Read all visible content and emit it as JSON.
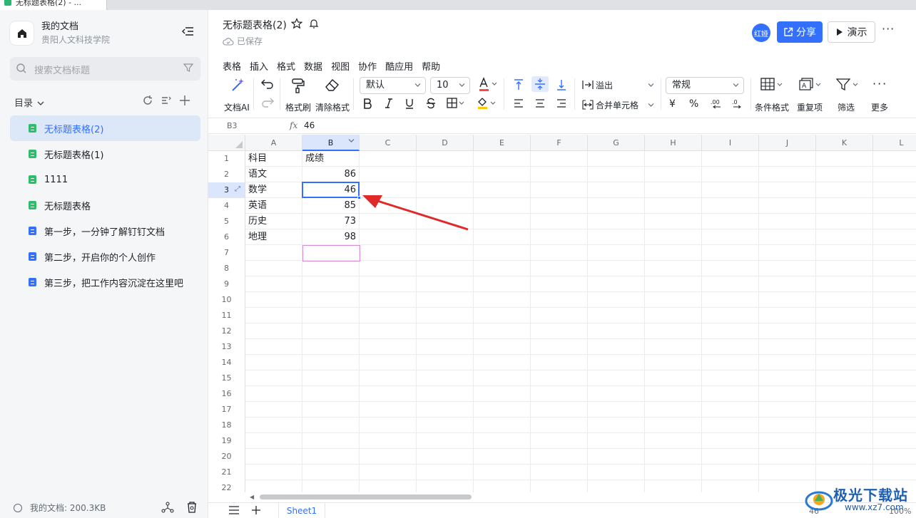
{
  "browser_tab": {
    "title": "无标题表格(2) - ..."
  },
  "sidebar": {
    "workspace_title": "我的文档",
    "workspace_subtitle": "贵阳人文科技学院",
    "search_placeholder": "搜索文档标题",
    "directory_label": "目录",
    "items": [
      {
        "label": "无标题表格(2)",
        "type": "sheet",
        "active": true
      },
      {
        "label": "无标题表格(1)",
        "type": "sheet",
        "active": false
      },
      {
        "label": "1111",
        "type": "sheet",
        "active": false
      },
      {
        "label": "无标题表格",
        "type": "sheet",
        "active": false
      },
      {
        "label": "第一步，一分钟了解钉钉文档",
        "type": "doc",
        "active": false
      },
      {
        "label": "第二步，开启你的个人创作",
        "type": "doc",
        "active": false
      },
      {
        "label": "第三步，把工作内容沉淀在这里吧",
        "type": "doc",
        "active": false
      }
    ],
    "storage_text": "我的文档: 200.3KB"
  },
  "header": {
    "doc_title": "无标题表格(2)",
    "saved_status": "已保存",
    "avatar_text": "红娅",
    "share_label": "分享",
    "present_label": "演示",
    "more_label": "···"
  },
  "menubar": [
    "表格",
    "插入",
    "格式",
    "数据",
    "视图",
    "协作",
    "酷应用",
    "帮助"
  ],
  "toolbar": {
    "ai_label": "文档AI",
    "format_painter_label": "格式刷",
    "clear_format_label": "清除格式",
    "font_name": "默认",
    "font_size": "10",
    "overflow_label": "溢出",
    "merge_label": "合并单元格",
    "number_format": "常规",
    "conditional_format_label": "条件格式",
    "duplicates_label": "重复项",
    "filter_label": "筛选",
    "more_label": "更多",
    "accent_color": "#3370ff",
    "font_color": "#f54a45",
    "fill_color": "#ffc60a"
  },
  "formula_bar": {
    "cell_ref": "B3",
    "fx": "fx",
    "value": "46"
  },
  "grid": {
    "columns": [
      "A",
      "B",
      "C",
      "D",
      "E",
      "F",
      "G",
      "H",
      "I",
      "J",
      "K",
      "L"
    ],
    "selected_column": "B",
    "selected_row": "3",
    "row_numbers": [
      "1",
      "2",
      "3",
      "4",
      "5",
      "6",
      "7",
      "8",
      "9",
      "10",
      "11",
      "12",
      "13",
      "14",
      "15",
      "16",
      "17",
      "18",
      "19",
      "20",
      "21",
      "22"
    ],
    "rows": [
      {
        "a": "科目",
        "b": "成绩"
      },
      {
        "a": "语文",
        "b": "86"
      },
      {
        "a": "数学",
        "b": "46"
      },
      {
        "a": "英语",
        "b": "85"
      },
      {
        "a": "历史",
        "b": "73"
      },
      {
        "a": "地理",
        "b": "98"
      }
    ]
  },
  "sheetbar": {
    "sheet_name": "Sheet1",
    "status_value": "46",
    "zoom": "100%"
  },
  "watermark": {
    "text": "极光下载站",
    "url": "www.xz7.com"
  }
}
